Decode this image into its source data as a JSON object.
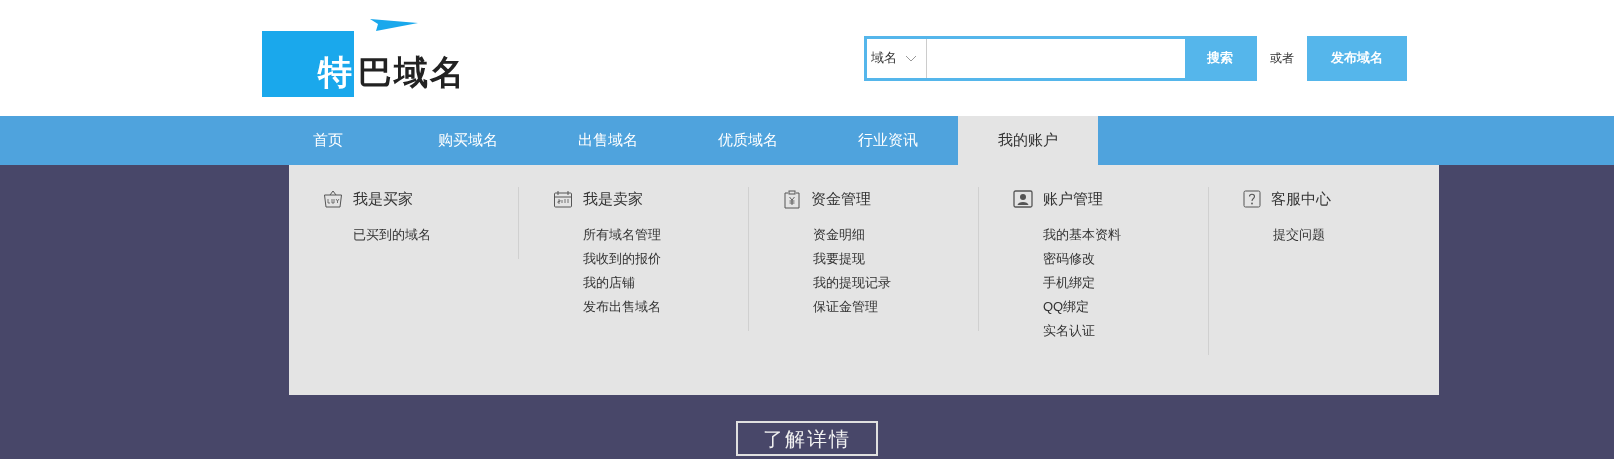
{
  "logo": {
    "text_highlight": "特",
    "text_rest": "巴域名"
  },
  "search": {
    "category": "域名",
    "button": "搜索"
  },
  "or_label": "或者",
  "publish_button": "发布域名",
  "nav": [
    {
      "label": "首页",
      "selected": false
    },
    {
      "label": "购买域名",
      "selected": false
    },
    {
      "label": "出售域名",
      "selected": false
    },
    {
      "label": "优质域名",
      "selected": false
    },
    {
      "label": "行业资讯",
      "selected": false
    },
    {
      "label": "我的账户",
      "selected": true
    }
  ],
  "banner": {
    "button": "了解详情"
  },
  "menu": [
    {
      "kind": "buyer",
      "title": "我是买家",
      "items": [
        "已买到的域名"
      ]
    },
    {
      "kind": "seller",
      "title": "我是卖家",
      "items": [
        "所有域名管理",
        "我收到的报价",
        "我的店铺",
        "发布出售域名"
      ]
    },
    {
      "kind": "funds",
      "title": "资金管理",
      "items": [
        "资金明细",
        "我要提现",
        "我的提现记录",
        "保证金管理"
      ]
    },
    {
      "kind": "account",
      "title": "账户管理",
      "items": [
        "我的基本资料",
        "密码修改",
        "手机绑定",
        "QQ绑定",
        "实名认证"
      ]
    },
    {
      "kind": "service",
      "title": "客服中心",
      "items": [
        "提交问题"
      ]
    }
  ]
}
